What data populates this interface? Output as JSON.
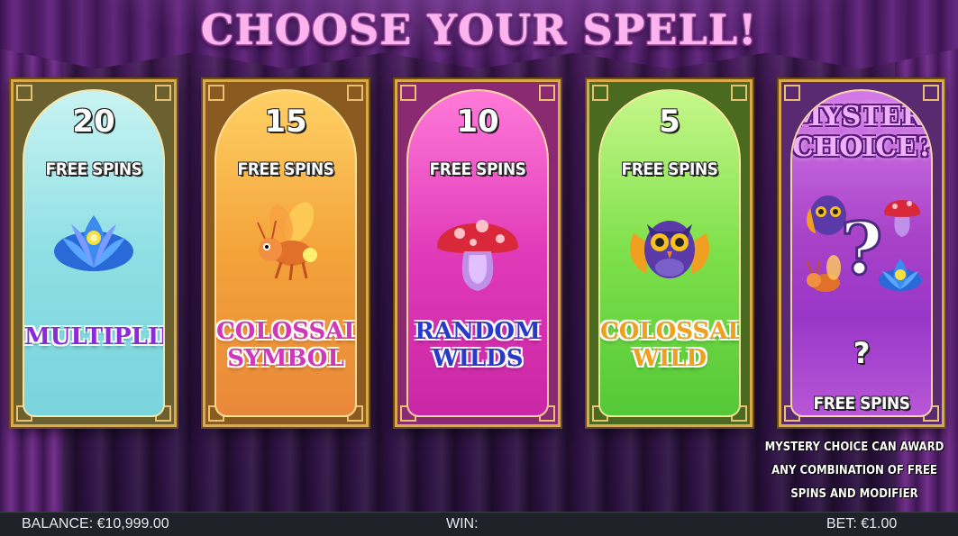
{
  "title": "CHOOSE YOUR SPELL!",
  "cards": [
    {
      "count": "20",
      "free_spins_label": "FREE SPINS",
      "symbol_icon": "blue-lotus-icon",
      "modifier": "MULTIPLIER",
      "modifier_lines": [
        "MULTIPLIER"
      ]
    },
    {
      "count": "15",
      "free_spins_label": "FREE SPINS",
      "symbol_icon": "firefly-icon",
      "modifier_lines": [
        "COLOSSAL",
        "SYMBOL"
      ]
    },
    {
      "count": "10",
      "free_spins_label": "FREE SPINS",
      "symbol_icon": "mushroom-icon",
      "modifier_lines": [
        "RANDOM",
        "WILDS"
      ]
    },
    {
      "count": "5",
      "free_spins_label": "FREE SPINS",
      "symbol_icon": "owl-icon",
      "modifier_lines": [
        "COLOSSAL",
        "WILD"
      ]
    }
  ],
  "mystery": {
    "title_lines": [
      "MYSTERY",
      "CHOICE?"
    ],
    "big_symbol": "?",
    "count": "?",
    "free_spins_label": "FREE SPINS",
    "note_lines": [
      "MYSTERY CHOICE CAN AWARD",
      "ANY COMBINATION OF FREE",
      "SPINS AND MODIFIER"
    ]
  },
  "status": {
    "balance": "BALANCE: €10,999.00",
    "win": "WIN:",
    "bet": "BET: €1.00"
  },
  "colors": {
    "card_1": "#8edfe4",
    "card_2": "#f3a33a",
    "card_3": "#e03ab8",
    "card_4": "#7ee04a",
    "card_5": "#a842c8",
    "frame_gold": "#d9a94a"
  }
}
